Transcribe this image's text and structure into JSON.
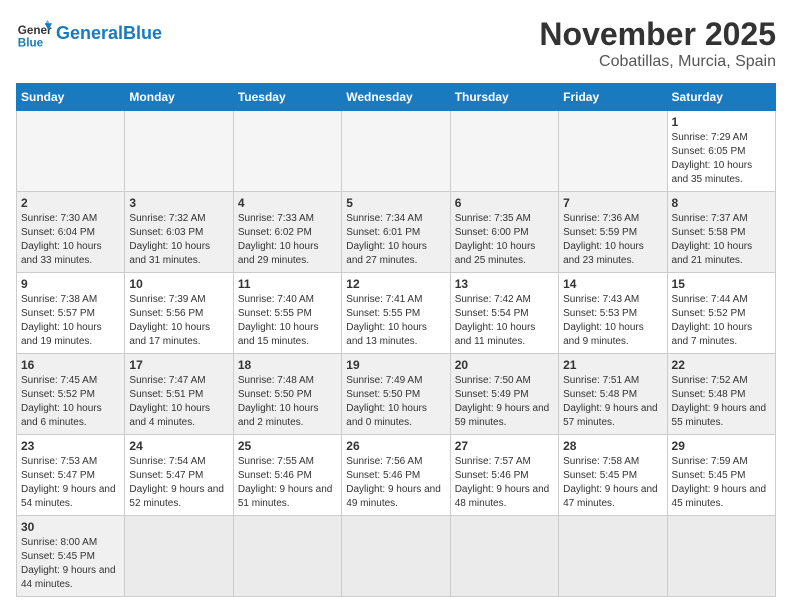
{
  "header": {
    "logo_general": "General",
    "logo_blue": "Blue",
    "month_title": "November 2025",
    "location": "Cobatillas, Murcia, Spain"
  },
  "days_of_week": [
    "Sunday",
    "Monday",
    "Tuesday",
    "Wednesday",
    "Thursday",
    "Friday",
    "Saturday"
  ],
  "weeks": [
    [
      {
        "day": "",
        "info": "",
        "empty": true
      },
      {
        "day": "",
        "info": "",
        "empty": true
      },
      {
        "day": "",
        "info": "",
        "empty": true
      },
      {
        "day": "",
        "info": "",
        "empty": true
      },
      {
        "day": "",
        "info": "",
        "empty": true
      },
      {
        "day": "",
        "info": "",
        "empty": true
      },
      {
        "day": "1",
        "info": "Sunrise: 7:29 AM\nSunset: 6:05 PM\nDaylight: 10 hours and 35 minutes.",
        "empty": false
      }
    ],
    [
      {
        "day": "2",
        "info": "Sunrise: 7:30 AM\nSunset: 6:04 PM\nDaylight: 10 hours and 33 minutes.",
        "empty": false
      },
      {
        "day": "3",
        "info": "Sunrise: 7:32 AM\nSunset: 6:03 PM\nDaylight: 10 hours and 31 minutes.",
        "empty": false
      },
      {
        "day": "4",
        "info": "Sunrise: 7:33 AM\nSunset: 6:02 PM\nDaylight: 10 hours and 29 minutes.",
        "empty": false
      },
      {
        "day": "5",
        "info": "Sunrise: 7:34 AM\nSunset: 6:01 PM\nDaylight: 10 hours and 27 minutes.",
        "empty": false
      },
      {
        "day": "6",
        "info": "Sunrise: 7:35 AM\nSunset: 6:00 PM\nDaylight: 10 hours and 25 minutes.",
        "empty": false
      },
      {
        "day": "7",
        "info": "Sunrise: 7:36 AM\nSunset: 5:59 PM\nDaylight: 10 hours and 23 minutes.",
        "empty": false
      },
      {
        "day": "8",
        "info": "Sunrise: 7:37 AM\nSunset: 5:58 PM\nDaylight: 10 hours and 21 minutes.",
        "empty": false
      }
    ],
    [
      {
        "day": "9",
        "info": "Sunrise: 7:38 AM\nSunset: 5:57 PM\nDaylight: 10 hours and 19 minutes.",
        "empty": false
      },
      {
        "day": "10",
        "info": "Sunrise: 7:39 AM\nSunset: 5:56 PM\nDaylight: 10 hours and 17 minutes.",
        "empty": false
      },
      {
        "day": "11",
        "info": "Sunrise: 7:40 AM\nSunset: 5:55 PM\nDaylight: 10 hours and 15 minutes.",
        "empty": false
      },
      {
        "day": "12",
        "info": "Sunrise: 7:41 AM\nSunset: 5:55 PM\nDaylight: 10 hours and 13 minutes.",
        "empty": false
      },
      {
        "day": "13",
        "info": "Sunrise: 7:42 AM\nSunset: 5:54 PM\nDaylight: 10 hours and 11 minutes.",
        "empty": false
      },
      {
        "day": "14",
        "info": "Sunrise: 7:43 AM\nSunset: 5:53 PM\nDaylight: 10 hours and 9 minutes.",
        "empty": false
      },
      {
        "day": "15",
        "info": "Sunrise: 7:44 AM\nSunset: 5:52 PM\nDaylight: 10 hours and 7 minutes.",
        "empty": false
      }
    ],
    [
      {
        "day": "16",
        "info": "Sunrise: 7:45 AM\nSunset: 5:52 PM\nDaylight: 10 hours and 6 minutes.",
        "empty": false
      },
      {
        "day": "17",
        "info": "Sunrise: 7:47 AM\nSunset: 5:51 PM\nDaylight: 10 hours and 4 minutes.",
        "empty": false
      },
      {
        "day": "18",
        "info": "Sunrise: 7:48 AM\nSunset: 5:50 PM\nDaylight: 10 hours and 2 minutes.",
        "empty": false
      },
      {
        "day": "19",
        "info": "Sunrise: 7:49 AM\nSunset: 5:50 PM\nDaylight: 10 hours and 0 minutes.",
        "empty": false
      },
      {
        "day": "20",
        "info": "Sunrise: 7:50 AM\nSunset: 5:49 PM\nDaylight: 9 hours and 59 minutes.",
        "empty": false
      },
      {
        "day": "21",
        "info": "Sunrise: 7:51 AM\nSunset: 5:48 PM\nDaylight: 9 hours and 57 minutes.",
        "empty": false
      },
      {
        "day": "22",
        "info": "Sunrise: 7:52 AM\nSunset: 5:48 PM\nDaylight: 9 hours and 55 minutes.",
        "empty": false
      }
    ],
    [
      {
        "day": "23",
        "info": "Sunrise: 7:53 AM\nSunset: 5:47 PM\nDaylight: 9 hours and 54 minutes.",
        "empty": false
      },
      {
        "day": "24",
        "info": "Sunrise: 7:54 AM\nSunset: 5:47 PM\nDaylight: 9 hours and 52 minutes.",
        "empty": false
      },
      {
        "day": "25",
        "info": "Sunrise: 7:55 AM\nSunset: 5:46 PM\nDaylight: 9 hours and 51 minutes.",
        "empty": false
      },
      {
        "day": "26",
        "info": "Sunrise: 7:56 AM\nSunset: 5:46 PM\nDaylight: 9 hours and 49 minutes.",
        "empty": false
      },
      {
        "day": "27",
        "info": "Sunrise: 7:57 AM\nSunset: 5:46 PM\nDaylight: 9 hours and 48 minutes.",
        "empty": false
      },
      {
        "day": "28",
        "info": "Sunrise: 7:58 AM\nSunset: 5:45 PM\nDaylight: 9 hours and 47 minutes.",
        "empty": false
      },
      {
        "day": "29",
        "info": "Sunrise: 7:59 AM\nSunset: 5:45 PM\nDaylight: 9 hours and 45 minutes.",
        "empty": false
      }
    ],
    [
      {
        "day": "30",
        "info": "Sunrise: 8:00 AM\nSunset: 5:45 PM\nDaylight: 9 hours and 44 minutes.",
        "empty": false
      },
      {
        "day": "",
        "info": "",
        "empty": true
      },
      {
        "day": "",
        "info": "",
        "empty": true
      },
      {
        "day": "",
        "info": "",
        "empty": true
      },
      {
        "day": "",
        "info": "",
        "empty": true
      },
      {
        "day": "",
        "info": "",
        "empty": true
      },
      {
        "day": "",
        "info": "",
        "empty": true
      }
    ]
  ]
}
